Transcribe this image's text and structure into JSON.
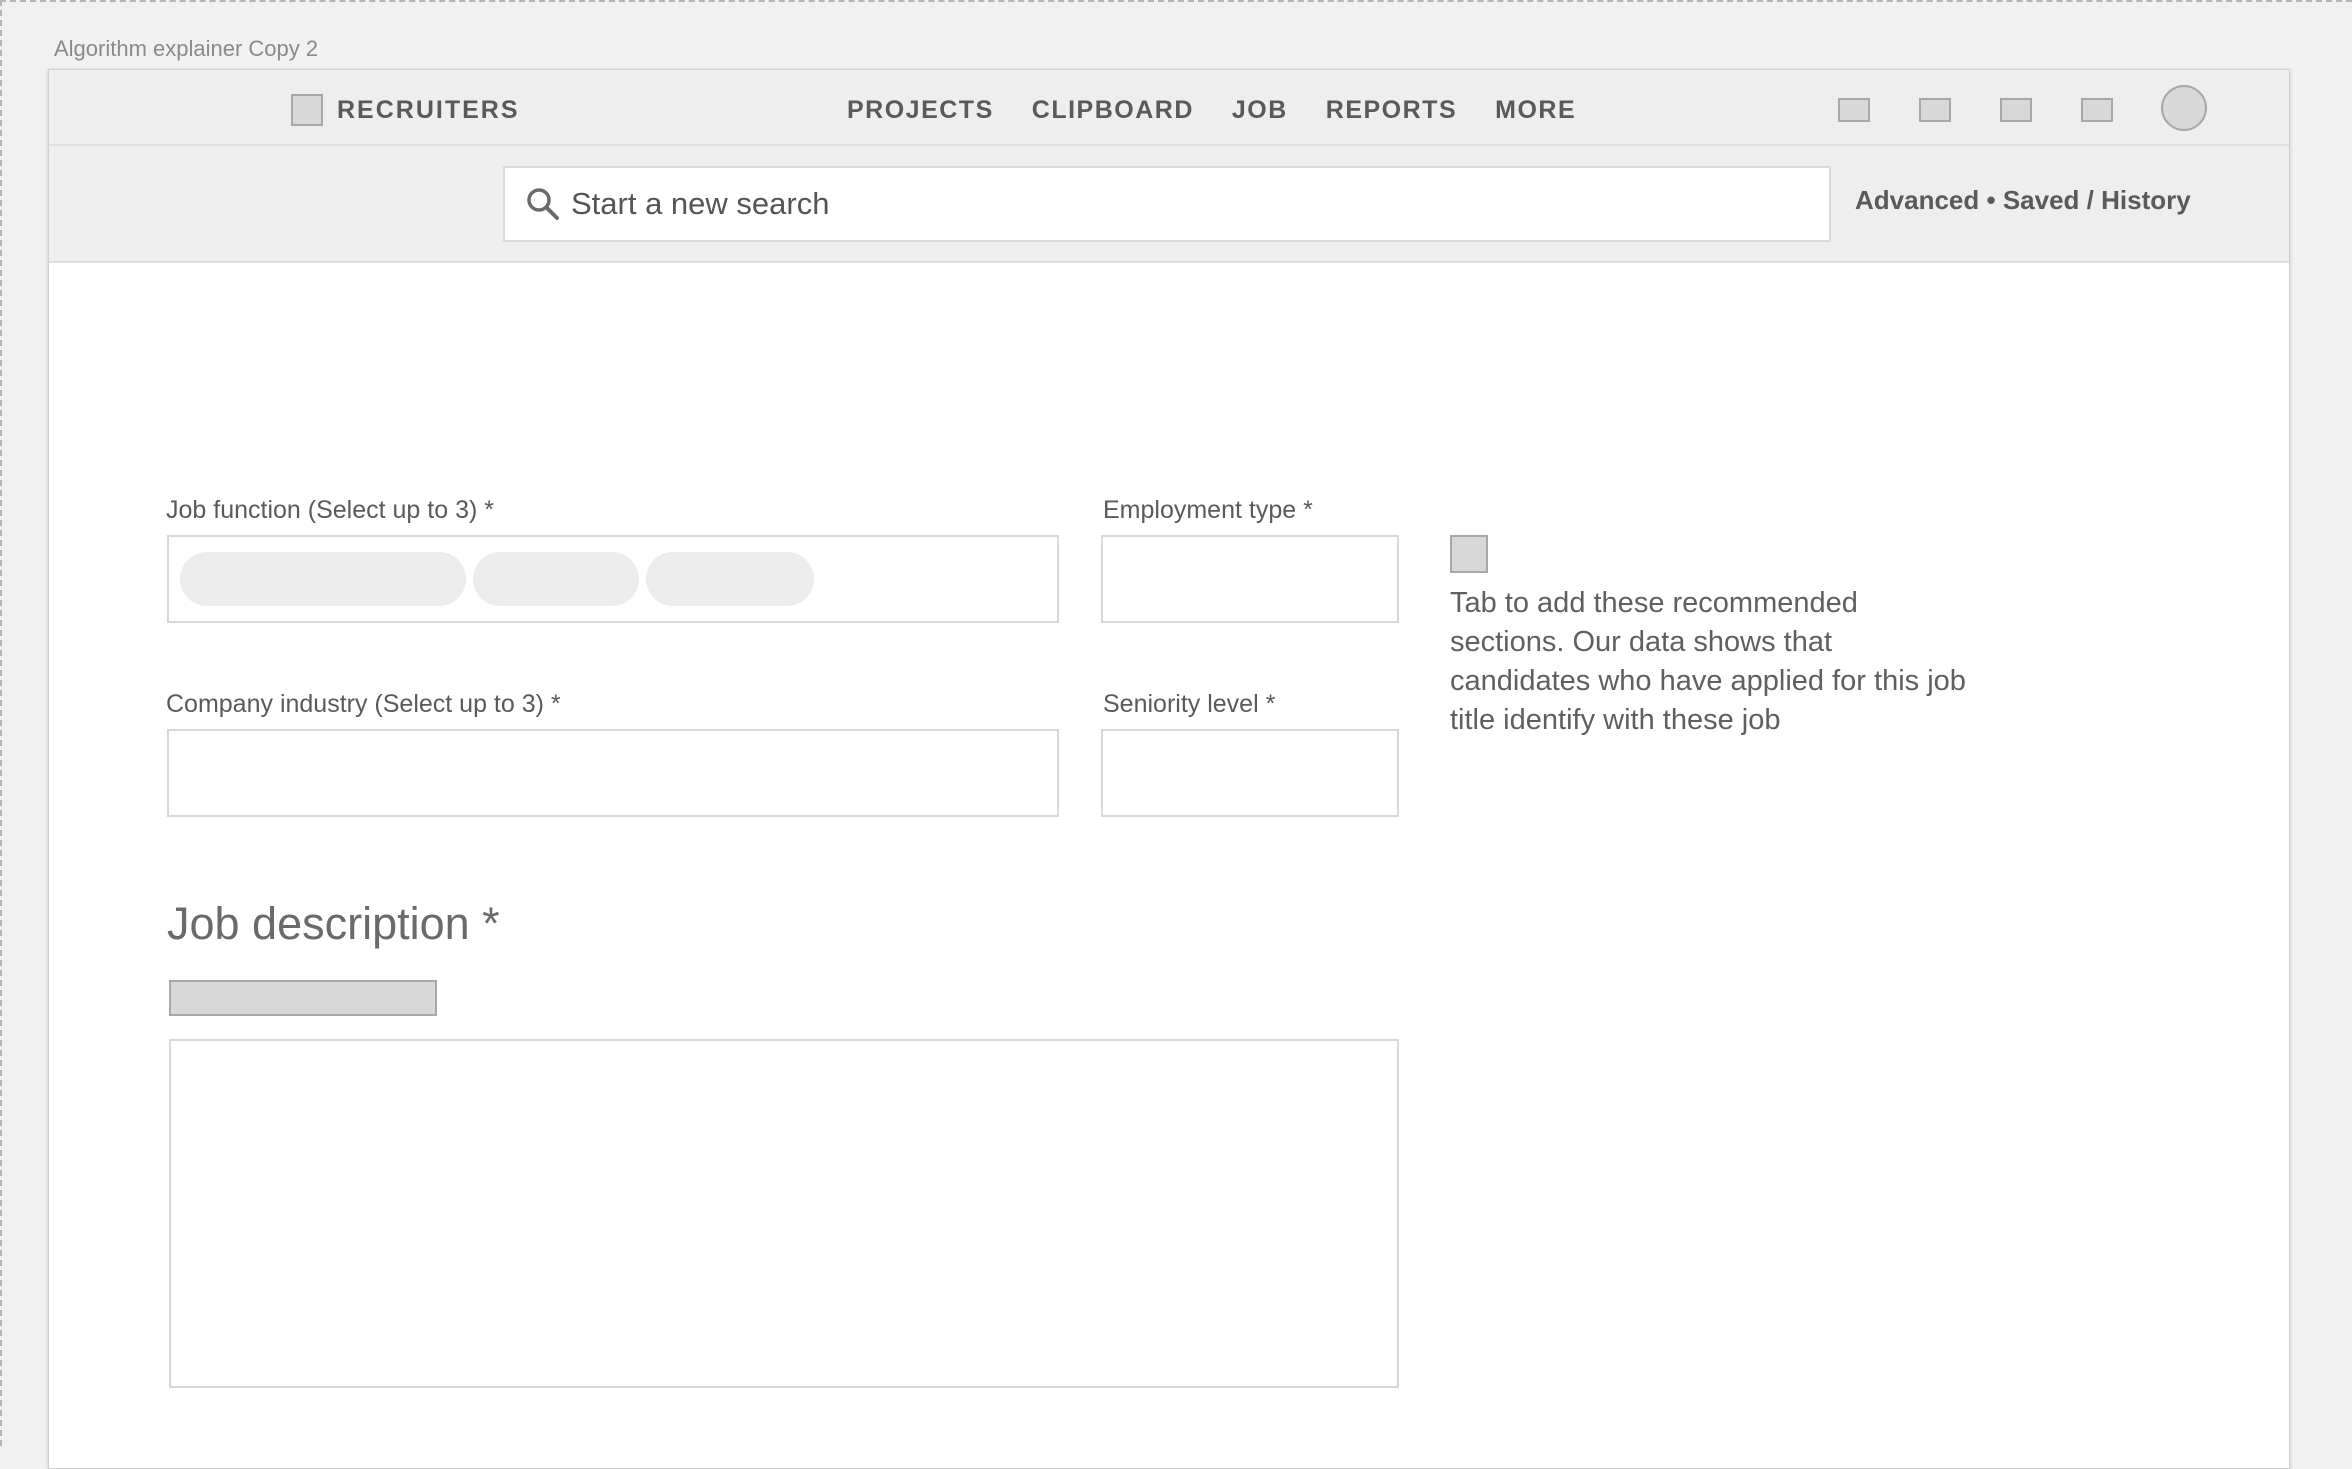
{
  "artboard_label": "Algorithm explainer Copy 2",
  "header": {
    "brand_label": "RECRUITERS",
    "nav": [
      "PROJECTS",
      "CLIPBOARD",
      "JOB",
      "REPORTS",
      "MORE"
    ]
  },
  "search": {
    "placeholder": "Start a new search",
    "link_advanced": "Advanced",
    "link_separator": " • ",
    "link_saved": "Saved / History"
  },
  "form": {
    "job_function_label": "Job function (Select up to 3) *",
    "employment_type_label": "Employment type *",
    "company_industry_label": "Company industry (Select up to 3) *",
    "seniority_level_label": "Seniority level *",
    "recommendation_text": "Tab to add these recommended sections. Our data shows that candidates who have applied for this job title identify with these job",
    "job_description_title": "Job description *"
  },
  "colors": {
    "canvas": "#f1f1f1",
    "bar": "#eeeeee",
    "placeholder_fill": "#d8d8d8",
    "chip_fill": "#ececec",
    "text": "#5a5a5a"
  }
}
